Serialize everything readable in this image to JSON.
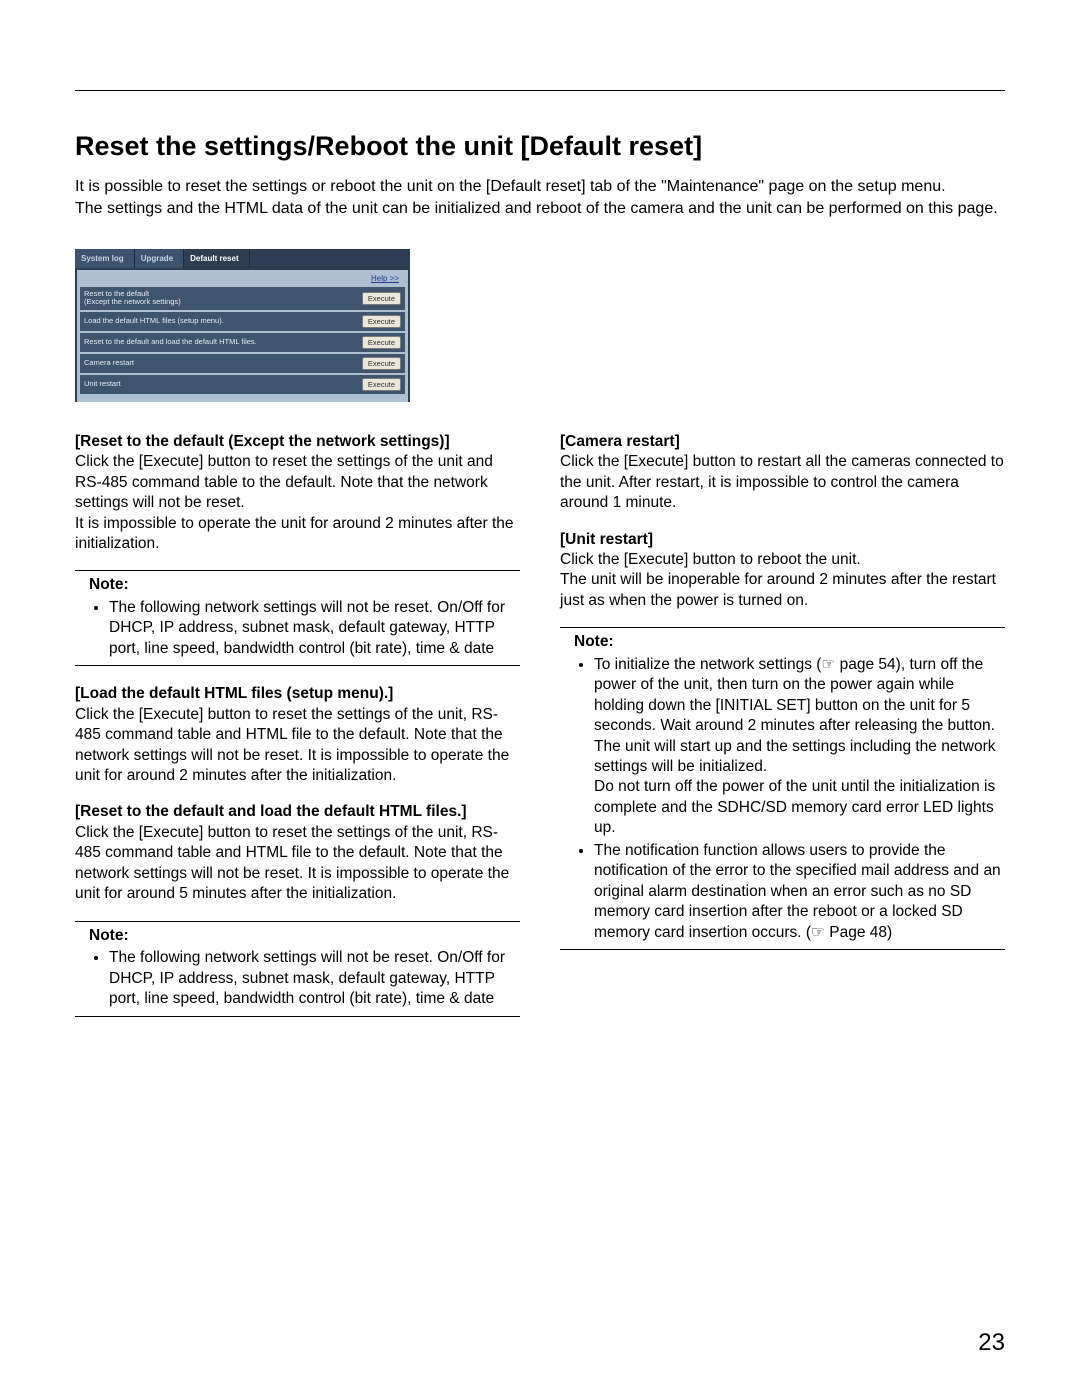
{
  "title": "Reset the settings/Reboot the unit [Default reset]",
  "intro": "It is possible to reset the settings or reboot the unit on the [Default reset] tab of the \"Maintenance\" page on the setup menu.\nThe settings and the HTML data of the unit can be initialized and reboot of the camera and the unit can be performed on this page.",
  "ui": {
    "tabs": [
      "System log",
      "Upgrade",
      "Default reset"
    ],
    "active_tab": 2,
    "help": "Help >>",
    "rows": [
      {
        "label": "Reset to the default\n(Except the network settings)",
        "button": "Execute"
      },
      {
        "label": "Load the default HTML files (setup menu).",
        "button": "Execute"
      },
      {
        "label": "Reset to the default and load the default HTML files.",
        "button": "Execute"
      },
      {
        "label": "Camera restart",
        "button": "Execute"
      },
      {
        "label": "Unit restart",
        "button": "Execute"
      }
    ]
  },
  "left": {
    "s1_head": "[Reset to the default (Except the network settings)]",
    "s1_body": "Click the [Execute] button to reset the settings of the unit and RS-485 command table to the default. Note that the network settings will not be reset.\nIt is impossible to operate the unit for around 2 minutes after the initialization.",
    "note1_label": "Note:",
    "note1_item": "The following network settings will not be reset. On/Off for DHCP, IP address, subnet mask, default gateway, HTTP port, line speed, bandwidth control (bit rate), time & date",
    "s2_head": "[Load the default HTML files (setup menu).]",
    "s2_body": "Click the [Execute] button to reset the settings of the unit, RS-485 command table and HTML file to the default. Note that the network settings will not be reset. It is impossible to operate the unit for around 2 minutes after the initialization.",
    "s3_head": "[Reset to the default and load the default HTML files.]",
    "s3_body": "Click the [Execute] button to reset the settings of the unit, RS-485 command table and HTML file to the default. Note that the network settings will not be reset. It is impossible to operate the unit for around 5 minutes after the initialization.",
    "note2_label": "Note:",
    "note2_item": "The following network settings will not be reset. On/Off for DHCP, IP address, subnet mask, default gateway, HTTP port, line speed, bandwidth control (bit rate), time & date"
  },
  "right": {
    "s1_head": "[Camera restart]",
    "s1_body": "Click the [Execute] button to restart all the cameras connected to the unit. After restart, it is impossible to control the camera around 1 minute.",
    "s2_head": "[Unit restart]",
    "s2_body": "Click the [Execute] button to reboot the unit.\nThe unit will be inoperable for around 2 minutes after the restart just as when the power is turned on.",
    "note_label": "Note:",
    "note_item1": "To initialize the network settings (☞ page 54), turn off the power of the unit, then turn on the power again while holding down the [INITIAL SET] button on the unit for 5 seconds. Wait around 2 minutes after releasing the button. The unit will start up and the settings including the network settings will be initialized.\nDo not turn off the power of the unit until the initialization is complete and the SDHC/SD memory card error LED lights up.",
    "note_item2": "The notification function allows users to provide the notification of the error to the specified mail address and an original alarm destination when an error such as no SD memory card insertion after the reboot or a locked SD memory card insertion occurs. (☞ Page 48)"
  },
  "page_number": "23"
}
